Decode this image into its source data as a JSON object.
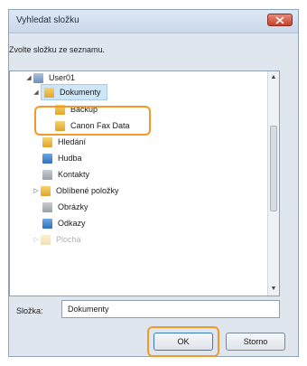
{
  "dialog": {
    "title": "Vyhledat složku",
    "prompt": "Zvolte složku ze seznamu."
  },
  "tree": {
    "items": [
      {
        "label": "User01",
        "icon": "user-folder-icon",
        "expander": "◢"
      },
      {
        "label": "Dokumenty",
        "icon": "yellow-folder-icon",
        "expander": "◢"
      },
      {
        "label": "Backup",
        "icon": "yellow-folder-icon",
        "expander": ""
      },
      {
        "label": "Canon Fax Data",
        "icon": "yellow-folder-icon",
        "expander": ""
      },
      {
        "label": "Hledání",
        "icon": "search-folder-icon",
        "expander": ""
      },
      {
        "label": "Hudba",
        "icon": "music-folder-icon",
        "expander": ""
      },
      {
        "label": "Kontakty",
        "icon": "contacts-folder-icon",
        "expander": ""
      },
      {
        "label": "Oblíbené položky",
        "icon": "yellow-folder-icon",
        "expander": "▷"
      },
      {
        "label": "Obrázky",
        "icon": "pictures-folder-icon",
        "expander": ""
      },
      {
        "label": "Odkazy",
        "icon": "links-folder-icon",
        "expander": ""
      },
      {
        "label": "Plocha",
        "icon": "yellow-folder-icon",
        "expander": "▷"
      }
    ],
    "scroll_up": "▲",
    "scroll_down": "▼"
  },
  "folder_field": {
    "label": "Složka:",
    "value": "Dokumenty"
  },
  "buttons": {
    "ok": "OK",
    "cancel": "Storno"
  },
  "colors": {
    "highlight": "#f19a2a",
    "selection": "#cfe5f8",
    "dialog_bg": "#dfe6ee"
  }
}
